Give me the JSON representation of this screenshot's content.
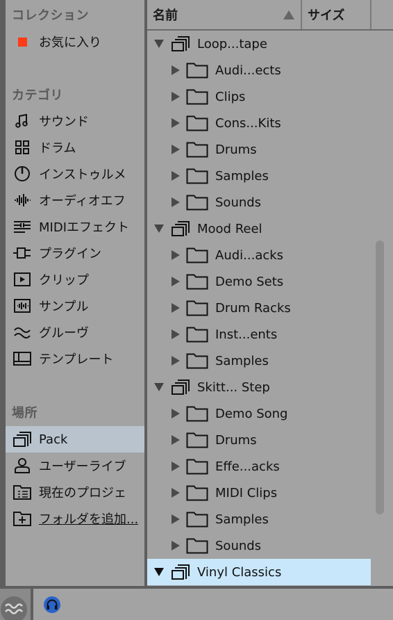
{
  "sidebar": {
    "collections_title": "コレクション",
    "favorites_label": "お気に入り",
    "favorites_color": "#ff3b16",
    "categories_title": "カテゴリ",
    "categories": [
      {
        "label": "サウンド",
        "icon": "music-note-icon"
      },
      {
        "label": "ドラム",
        "icon": "drum-grid-icon"
      },
      {
        "label": "インストゥルメ",
        "icon": "instrument-dial-icon"
      },
      {
        "label": "オーディオエフ",
        "icon": "audio-waveform-icon"
      },
      {
        "label": "MIDIエフェクト",
        "icon": "midi-lines-icon"
      },
      {
        "label": "プラグイン",
        "icon": "plug-icon"
      },
      {
        "label": "クリップ",
        "icon": "clip-play-icon"
      },
      {
        "label": "サンプル",
        "icon": "sample-wave-icon"
      },
      {
        "label": "グルーヴ",
        "icon": "groove-wave-icon"
      },
      {
        "label": "テンプレート",
        "icon": "template-icon"
      }
    ],
    "places_title": "場所",
    "places": [
      {
        "label": "Pack",
        "icon": "pack-stack-icon",
        "selected": true
      },
      {
        "label": "ユーザーライブ",
        "icon": "user-icon",
        "selected": false
      },
      {
        "label": "現在のプロジェ",
        "icon": "project-folder-icon",
        "selected": false
      },
      {
        "label": "フォルダを追加...",
        "icon": "add-folder-icon",
        "selected": false
      }
    ]
  },
  "browser": {
    "columns": {
      "name": "名前",
      "size": "サイズ"
    },
    "rows": [
      {
        "label": "Loop...tape",
        "kind": "pack",
        "expanded": true
      },
      {
        "label": "Audi...ects",
        "kind": "folder",
        "expanded": false
      },
      {
        "label": "Clips",
        "kind": "folder",
        "expanded": false
      },
      {
        "label": "Cons...Kits",
        "kind": "folder",
        "expanded": false
      },
      {
        "label": "Drums",
        "kind": "folder",
        "expanded": false
      },
      {
        "label": "Samples",
        "kind": "folder",
        "expanded": false
      },
      {
        "label": "Sounds",
        "kind": "folder",
        "expanded": false
      },
      {
        "label": "Mood Reel",
        "kind": "pack",
        "expanded": true
      },
      {
        "label": "Audi...acks",
        "kind": "folder",
        "expanded": false
      },
      {
        "label": "Demo Sets",
        "kind": "folder",
        "expanded": false
      },
      {
        "label": "Drum Racks",
        "kind": "folder",
        "expanded": false
      },
      {
        "label": "Inst...ents",
        "kind": "folder",
        "expanded": false
      },
      {
        "label": "Samples",
        "kind": "folder",
        "expanded": false
      },
      {
        "label": "Skitt... Step",
        "kind": "pack",
        "expanded": true
      },
      {
        "label": "Demo Song",
        "kind": "folder",
        "expanded": false
      },
      {
        "label": "Drums",
        "kind": "folder",
        "expanded": false
      },
      {
        "label": "Effe...acks",
        "kind": "folder",
        "expanded": false
      },
      {
        "label": "MIDI Clips",
        "kind": "folder",
        "expanded": false
      },
      {
        "label": "Samples",
        "kind": "folder",
        "expanded": false
      },
      {
        "label": "Sounds",
        "kind": "folder",
        "expanded": false
      },
      {
        "label": "Vinyl Classics",
        "kind": "pack",
        "expanded": true,
        "selected": true
      }
    ],
    "selected_row_color": "#c9e7fa"
  },
  "footer": {
    "left_icon": "groove-toggle-icon",
    "preview_icon": "headphones-icon"
  }
}
